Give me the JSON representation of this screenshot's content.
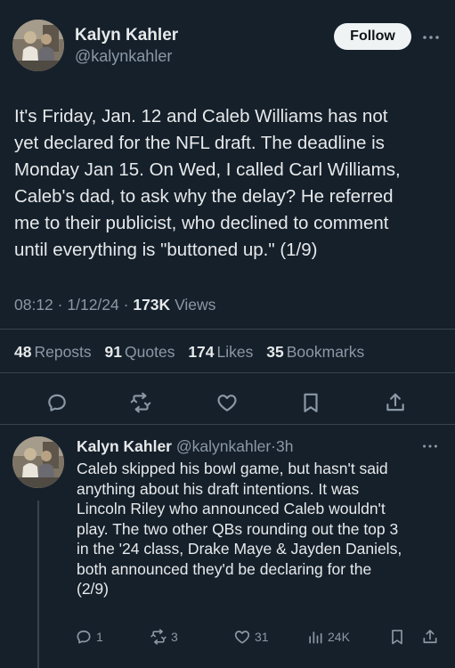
{
  "author": {
    "display_name": "Kalyn Kahler",
    "handle": "@kalynkahler"
  },
  "follow_label": "Follow",
  "tweet": {
    "text": "It's Friday, Jan. 12 and Caleb Williams has not\nyet declared for the NFL draft. The deadline is\nMonday Jan 15. On Wed, I called Carl Williams,\nCaleb's dad, to ask why the delay? He referred\nme to their publicist, who declined to comment\nuntil everything is \"buttoned up.\" (1/9)",
    "time": "08:12",
    "date": "1/12/24",
    "separator": "·",
    "views_count": "173K",
    "views_label": "Views"
  },
  "stats": {
    "reposts": {
      "count": "48",
      "label": "Reposts"
    },
    "quotes": {
      "count": "91",
      "label": "Quotes"
    },
    "likes": {
      "count": "174",
      "label": "Likes"
    },
    "bookmarks": {
      "count": "35",
      "label": "Bookmarks"
    }
  },
  "actions": [
    "reply-icon",
    "repost-icon",
    "like-icon",
    "bookmark-icon",
    "share-icon"
  ],
  "reply": {
    "display_name": "Kalyn Kahler",
    "handle": "@kalynkahler",
    "separator": "·",
    "time": "3h",
    "text": "Caleb skipped his bowl game, but hasn't said\nanything about his draft intentions. It was\nLincoln Riley who announced Caleb wouldn't\nplay. The two other QBs rounding out the top 3\nin the '24 class, Drake Maye & Jayden Daniels,\nboth announced they'd be declaring for the\n(2/9)",
    "counts": {
      "replies": "1",
      "reposts": "3",
      "likes": "31",
      "views": "24K"
    }
  },
  "colors": {
    "background": "#15202b",
    "text": "#e7e9ea",
    "muted": "#8b98a5",
    "divider": "#38444d"
  }
}
